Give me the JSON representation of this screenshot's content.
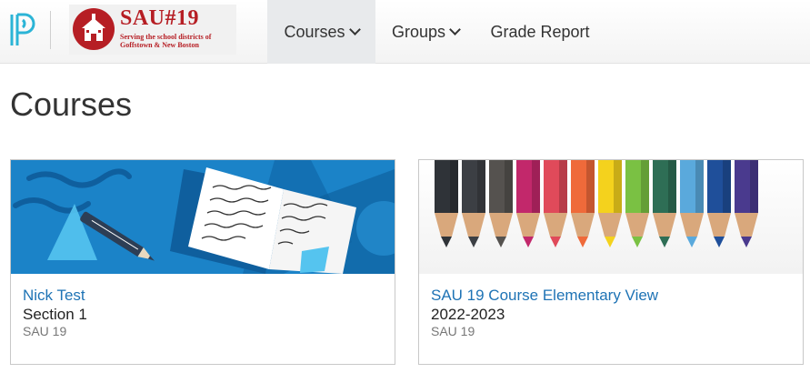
{
  "header": {
    "logo_icon": "powerschool-p-icon",
    "district_logo": {
      "title": "SAU#19",
      "subtitle": "Serving the school districts of Goffstown & New Boston",
      "icon": "schoolhouse-icon"
    },
    "nav": [
      {
        "label": "Courses",
        "has_dropdown": true,
        "active": true
      },
      {
        "label": "Groups",
        "has_dropdown": true,
        "active": false
      },
      {
        "label": "Grade Report",
        "has_dropdown": false,
        "active": false
      }
    ]
  },
  "page": {
    "title": "Courses"
  },
  "courses": [
    {
      "name": "Nick Test",
      "section": "Section 1",
      "school": "SAU 19",
      "image": "notebook-pencil-illustration"
    },
    {
      "name": "SAU 19 Course Elementary View",
      "section": "2022-2023",
      "school": "SAU 19",
      "image": "colored-pencils-photo"
    }
  ],
  "colors": {
    "link": "#1e73b5",
    "brand_red": "#b61e24",
    "card_blue": "#1a7fc4"
  }
}
